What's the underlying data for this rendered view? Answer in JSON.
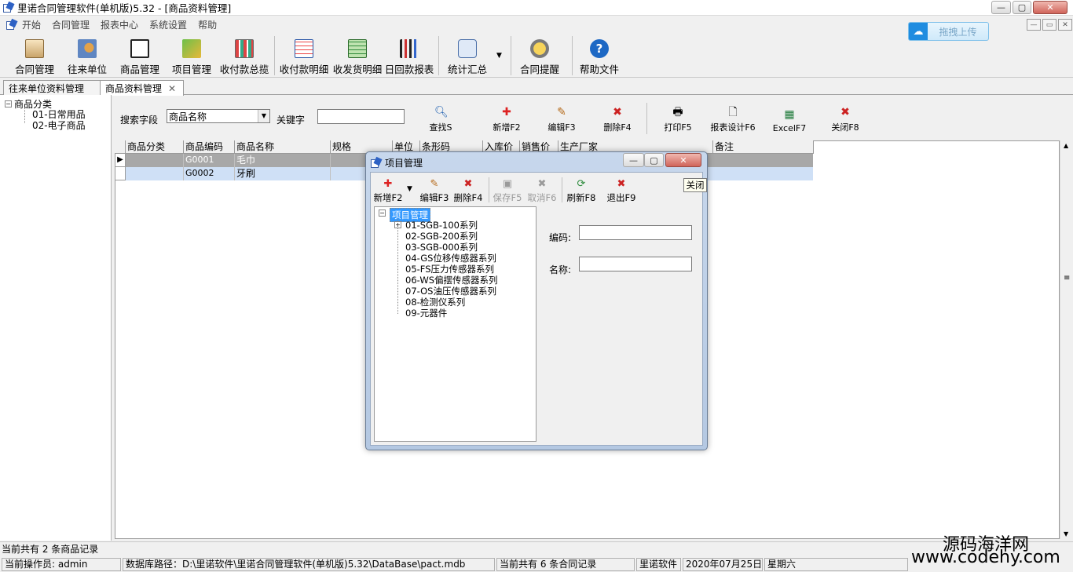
{
  "window": {
    "title": "里诺合同管理软件(单机版)5.32 - [商品资料管理]"
  },
  "menu": [
    "开始",
    "合同管理",
    "报表中心",
    "系统设置",
    "帮助"
  ],
  "upload_label": "拖拽上传",
  "toolbar": [
    "合同管理",
    "往来单位",
    "商品管理",
    "项目管理",
    "收付款总揽",
    "收付款明细",
    "收发货明细",
    "日回款报表",
    "统计汇总",
    "合同提醒",
    "帮助文件"
  ],
  "tabs": [
    "往来单位资料管理",
    "商品资料管理"
  ],
  "category_tree": {
    "root": "商品分类",
    "children": [
      "01-日常用品",
      "02-电子商品"
    ]
  },
  "search": {
    "field_label": "搜索字段",
    "field_value": "商品名称",
    "keyword_label": "关键字",
    "keyword_value": ""
  },
  "actions": [
    "查找S",
    "新增F2",
    "编辑F3",
    "删除F4",
    "打印F5",
    "报表设计F6",
    "ExcelF7",
    "关闭F8"
  ],
  "grid": {
    "columns": [
      "商品分类",
      "商品编码",
      "商品名称",
      "规格",
      "单位",
      "条形码",
      "入库价",
      "销售价",
      "生产厂家",
      "备注"
    ],
    "rows": [
      {
        "code": "G0001",
        "name": "毛巾"
      },
      {
        "code": "G0002",
        "name": "牙刷"
      }
    ]
  },
  "dialog": {
    "title": "项目管理",
    "buttons": [
      "新增F2",
      "编辑F3",
      "删除F4",
      "保存F5",
      "取消F6",
      "刷新F8",
      "退出F9"
    ],
    "tooltip": "关闭",
    "tree_root": "项目管理",
    "tree_items": [
      "01-SGB-100系列",
      "02-SGB-200系列",
      "03-SGB-000系列",
      "04-GS位移传感器系列",
      "05-FS压力传感器系列",
      "06-WS偏摆传感器系列",
      "07-OS油压传感器系列",
      "08-检测仪系列",
      "09-元器件"
    ],
    "code_label": "编码:",
    "name_label": "名称:"
  },
  "status": {
    "record_count": "当前共有 2 条商品记录",
    "operator": "当前操作员: admin",
    "db_path": "数据库路径：D:\\里诺软件\\里诺合同管理软件(单机版)5.32\\DataBase\\pact.mdb",
    "contracts": "当前共有 6 条合同记录",
    "company": "里诺软件",
    "date": "2020年07月25日",
    "weekday": "星期六"
  },
  "watermark": {
    "line1": "源码海洋网",
    "line2": "www.codehy.com"
  }
}
